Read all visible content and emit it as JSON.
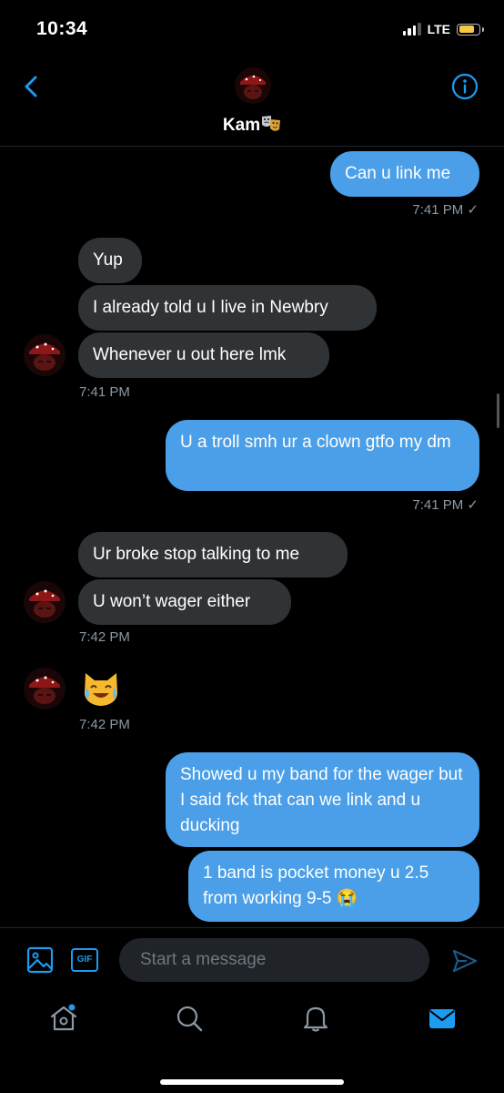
{
  "status_bar": {
    "time": "10:34",
    "network": "LTE",
    "battery_color": "#f6c944"
  },
  "header": {
    "name": "Kam",
    "name_emoji": "performing-arts-masks"
  },
  "colors": {
    "accent": "#1d9bf0",
    "outgoing_bubble": "#4a9fe8",
    "incoming_bubble": "#2f3336",
    "timestamp": "#8b98a5"
  },
  "messages": [
    {
      "direction": "out",
      "text": "Can u link me"
    },
    {
      "direction": "out",
      "timestamp": "7:41 PM ✓"
    },
    {
      "direction": "in",
      "text": "Yup"
    },
    {
      "direction": "in",
      "text": "I already told u I live in Newbry"
    },
    {
      "direction": "in",
      "text": "Whenever u out here lmk"
    },
    {
      "direction": "in",
      "timestamp": "7:41 PM"
    },
    {
      "direction": "out",
      "text": "U a troll smh ur a clown gtfo my dm"
    },
    {
      "direction": "out",
      "timestamp": "7:41 PM ✓"
    },
    {
      "direction": "in",
      "text": "Ur broke stop talking to me"
    },
    {
      "direction": "in",
      "text": "U won’t wager either"
    },
    {
      "direction": "in",
      "timestamp": "7:42 PM"
    },
    {
      "direction": "in",
      "emoji": "cat-with-tears-of-joy"
    },
    {
      "direction": "in",
      "timestamp": "7:42 PM"
    },
    {
      "direction": "out",
      "text": "Showed u my band for the wager but I said fck that can we link and u ducking"
    },
    {
      "direction": "out",
      "text": "1 band is pocket money u 2.5 from working 9-5 😭"
    }
  ],
  "composer": {
    "placeholder": "Start a message",
    "gif_label": "GIF"
  },
  "tab_bar": [
    "home-icon",
    "search-icon",
    "notifications-icon",
    "messages-icon"
  ]
}
